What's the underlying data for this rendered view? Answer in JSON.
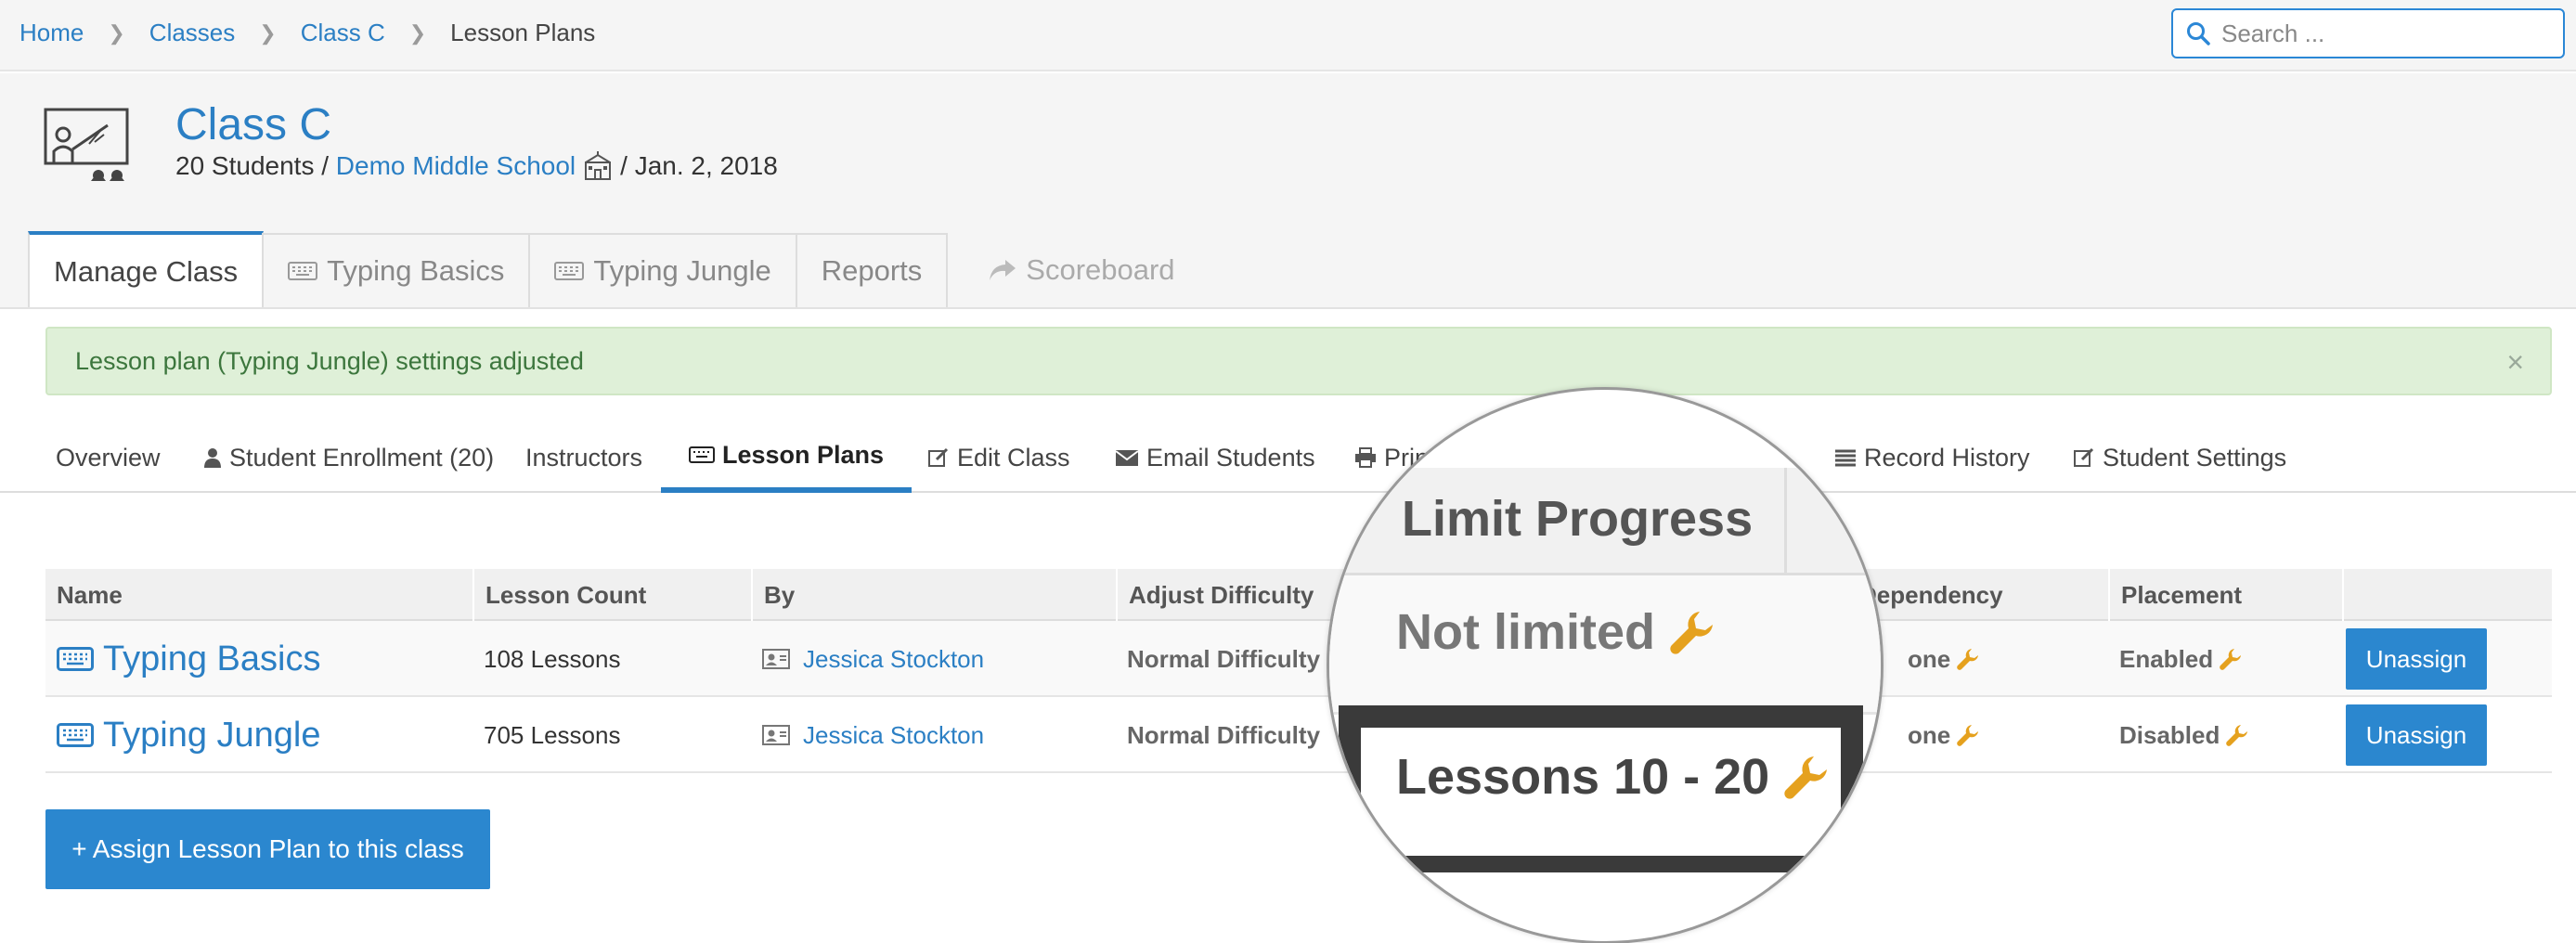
{
  "breadcrumb": {
    "items": [
      "Home",
      "Classes",
      "Class C"
    ],
    "current": "Lesson Plans"
  },
  "search": {
    "placeholder": "Search ..."
  },
  "class": {
    "title": "Class C",
    "students": "20 Students /",
    "school": "Demo Middle School",
    "date": "/ Jan. 2, 2018"
  },
  "main_tabs": [
    "Manage Class",
    "Typing Basics",
    "Typing Jungle",
    "Reports",
    "Scoreboard"
  ],
  "alert": {
    "message": "Lesson plan (Typing Jungle) settings adjusted",
    "close": "×"
  },
  "subnav": [
    "Overview",
    "Student Enrollment (20)",
    "Instructors",
    "Lesson Plans",
    "Edit Class",
    "Email Students",
    "Print",
    "Record History",
    "Student Settings"
  ],
  "table": {
    "headers": [
      "Name",
      "Lesson Count",
      "By",
      "Adjust Difficulty",
      "Dependency",
      "Placement"
    ],
    "rows": [
      {
        "name": "Typing Basics",
        "count": "108 Lessons",
        "by": "Jessica Stockton",
        "difficulty": "Normal Difficulty",
        "dependency": "one",
        "placement": "Enabled",
        "action": "Unassign"
      },
      {
        "name": "Typing Jungle",
        "count": "705 Lessons",
        "by": "Jessica Stockton",
        "difficulty": "Normal Difficulty",
        "dependency": "one",
        "placement": "Disabled",
        "action": "Unassign"
      }
    ]
  },
  "assign_button": "+ Assign Lesson Plan to this class",
  "magnifier": {
    "header": "Limit Progress",
    "row1": "Not limited",
    "row2": "Lessons 10 - 20"
  },
  "colors": {
    "accent": "#2b7fc4",
    "button": "#2b87cf",
    "alert_bg": "#dff0d8",
    "alert_text": "#3c763d",
    "wrench": "#e5a11e"
  }
}
